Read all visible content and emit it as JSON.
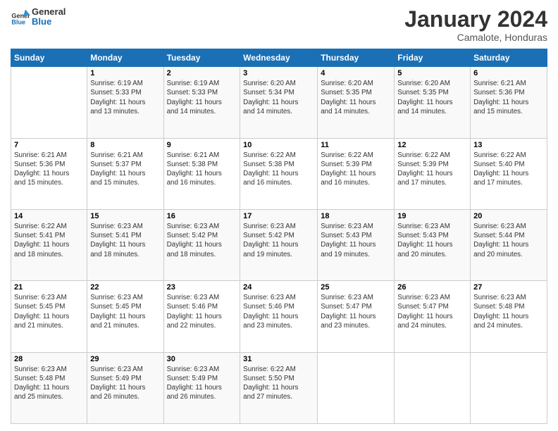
{
  "logo": {
    "line1": "General",
    "line2": "Blue"
  },
  "title": "January 2024",
  "subtitle": "Camalote, Honduras",
  "days_header": [
    "Sunday",
    "Monday",
    "Tuesday",
    "Wednesday",
    "Thursday",
    "Friday",
    "Saturday"
  ],
  "weeks": [
    [
      {
        "num": "",
        "info": ""
      },
      {
        "num": "1",
        "info": "Sunrise: 6:19 AM\nSunset: 5:33 PM\nDaylight: 11 hours\nand 13 minutes."
      },
      {
        "num": "2",
        "info": "Sunrise: 6:19 AM\nSunset: 5:33 PM\nDaylight: 11 hours\nand 14 minutes."
      },
      {
        "num": "3",
        "info": "Sunrise: 6:20 AM\nSunset: 5:34 PM\nDaylight: 11 hours\nand 14 minutes."
      },
      {
        "num": "4",
        "info": "Sunrise: 6:20 AM\nSunset: 5:35 PM\nDaylight: 11 hours\nand 14 minutes."
      },
      {
        "num": "5",
        "info": "Sunrise: 6:20 AM\nSunset: 5:35 PM\nDaylight: 11 hours\nand 14 minutes."
      },
      {
        "num": "6",
        "info": "Sunrise: 6:21 AM\nSunset: 5:36 PM\nDaylight: 11 hours\nand 15 minutes."
      }
    ],
    [
      {
        "num": "7",
        "info": "Sunrise: 6:21 AM\nSunset: 5:36 PM\nDaylight: 11 hours\nand 15 minutes."
      },
      {
        "num": "8",
        "info": "Sunrise: 6:21 AM\nSunset: 5:37 PM\nDaylight: 11 hours\nand 15 minutes."
      },
      {
        "num": "9",
        "info": "Sunrise: 6:21 AM\nSunset: 5:38 PM\nDaylight: 11 hours\nand 16 minutes."
      },
      {
        "num": "10",
        "info": "Sunrise: 6:22 AM\nSunset: 5:38 PM\nDaylight: 11 hours\nand 16 minutes."
      },
      {
        "num": "11",
        "info": "Sunrise: 6:22 AM\nSunset: 5:39 PM\nDaylight: 11 hours\nand 16 minutes."
      },
      {
        "num": "12",
        "info": "Sunrise: 6:22 AM\nSunset: 5:39 PM\nDaylight: 11 hours\nand 17 minutes."
      },
      {
        "num": "13",
        "info": "Sunrise: 6:22 AM\nSunset: 5:40 PM\nDaylight: 11 hours\nand 17 minutes."
      }
    ],
    [
      {
        "num": "14",
        "info": "Sunrise: 6:22 AM\nSunset: 5:41 PM\nDaylight: 11 hours\nand 18 minutes."
      },
      {
        "num": "15",
        "info": "Sunrise: 6:23 AM\nSunset: 5:41 PM\nDaylight: 11 hours\nand 18 minutes."
      },
      {
        "num": "16",
        "info": "Sunrise: 6:23 AM\nSunset: 5:42 PM\nDaylight: 11 hours\nand 18 minutes."
      },
      {
        "num": "17",
        "info": "Sunrise: 6:23 AM\nSunset: 5:42 PM\nDaylight: 11 hours\nand 19 minutes."
      },
      {
        "num": "18",
        "info": "Sunrise: 6:23 AM\nSunset: 5:43 PM\nDaylight: 11 hours\nand 19 minutes."
      },
      {
        "num": "19",
        "info": "Sunrise: 6:23 AM\nSunset: 5:43 PM\nDaylight: 11 hours\nand 20 minutes."
      },
      {
        "num": "20",
        "info": "Sunrise: 6:23 AM\nSunset: 5:44 PM\nDaylight: 11 hours\nand 20 minutes."
      }
    ],
    [
      {
        "num": "21",
        "info": "Sunrise: 6:23 AM\nSunset: 5:45 PM\nDaylight: 11 hours\nand 21 minutes."
      },
      {
        "num": "22",
        "info": "Sunrise: 6:23 AM\nSunset: 5:45 PM\nDaylight: 11 hours\nand 21 minutes."
      },
      {
        "num": "23",
        "info": "Sunrise: 6:23 AM\nSunset: 5:46 PM\nDaylight: 11 hours\nand 22 minutes."
      },
      {
        "num": "24",
        "info": "Sunrise: 6:23 AM\nSunset: 5:46 PM\nDaylight: 11 hours\nand 23 minutes."
      },
      {
        "num": "25",
        "info": "Sunrise: 6:23 AM\nSunset: 5:47 PM\nDaylight: 11 hours\nand 23 minutes."
      },
      {
        "num": "26",
        "info": "Sunrise: 6:23 AM\nSunset: 5:47 PM\nDaylight: 11 hours\nand 24 minutes."
      },
      {
        "num": "27",
        "info": "Sunrise: 6:23 AM\nSunset: 5:48 PM\nDaylight: 11 hours\nand 24 minutes."
      }
    ],
    [
      {
        "num": "28",
        "info": "Sunrise: 6:23 AM\nSunset: 5:48 PM\nDaylight: 11 hours\nand 25 minutes."
      },
      {
        "num": "29",
        "info": "Sunrise: 6:23 AM\nSunset: 5:49 PM\nDaylight: 11 hours\nand 26 minutes."
      },
      {
        "num": "30",
        "info": "Sunrise: 6:23 AM\nSunset: 5:49 PM\nDaylight: 11 hours\nand 26 minutes."
      },
      {
        "num": "31",
        "info": "Sunrise: 6:22 AM\nSunset: 5:50 PM\nDaylight: 11 hours\nand 27 minutes."
      },
      {
        "num": "",
        "info": ""
      },
      {
        "num": "",
        "info": ""
      },
      {
        "num": "",
        "info": ""
      }
    ]
  ]
}
